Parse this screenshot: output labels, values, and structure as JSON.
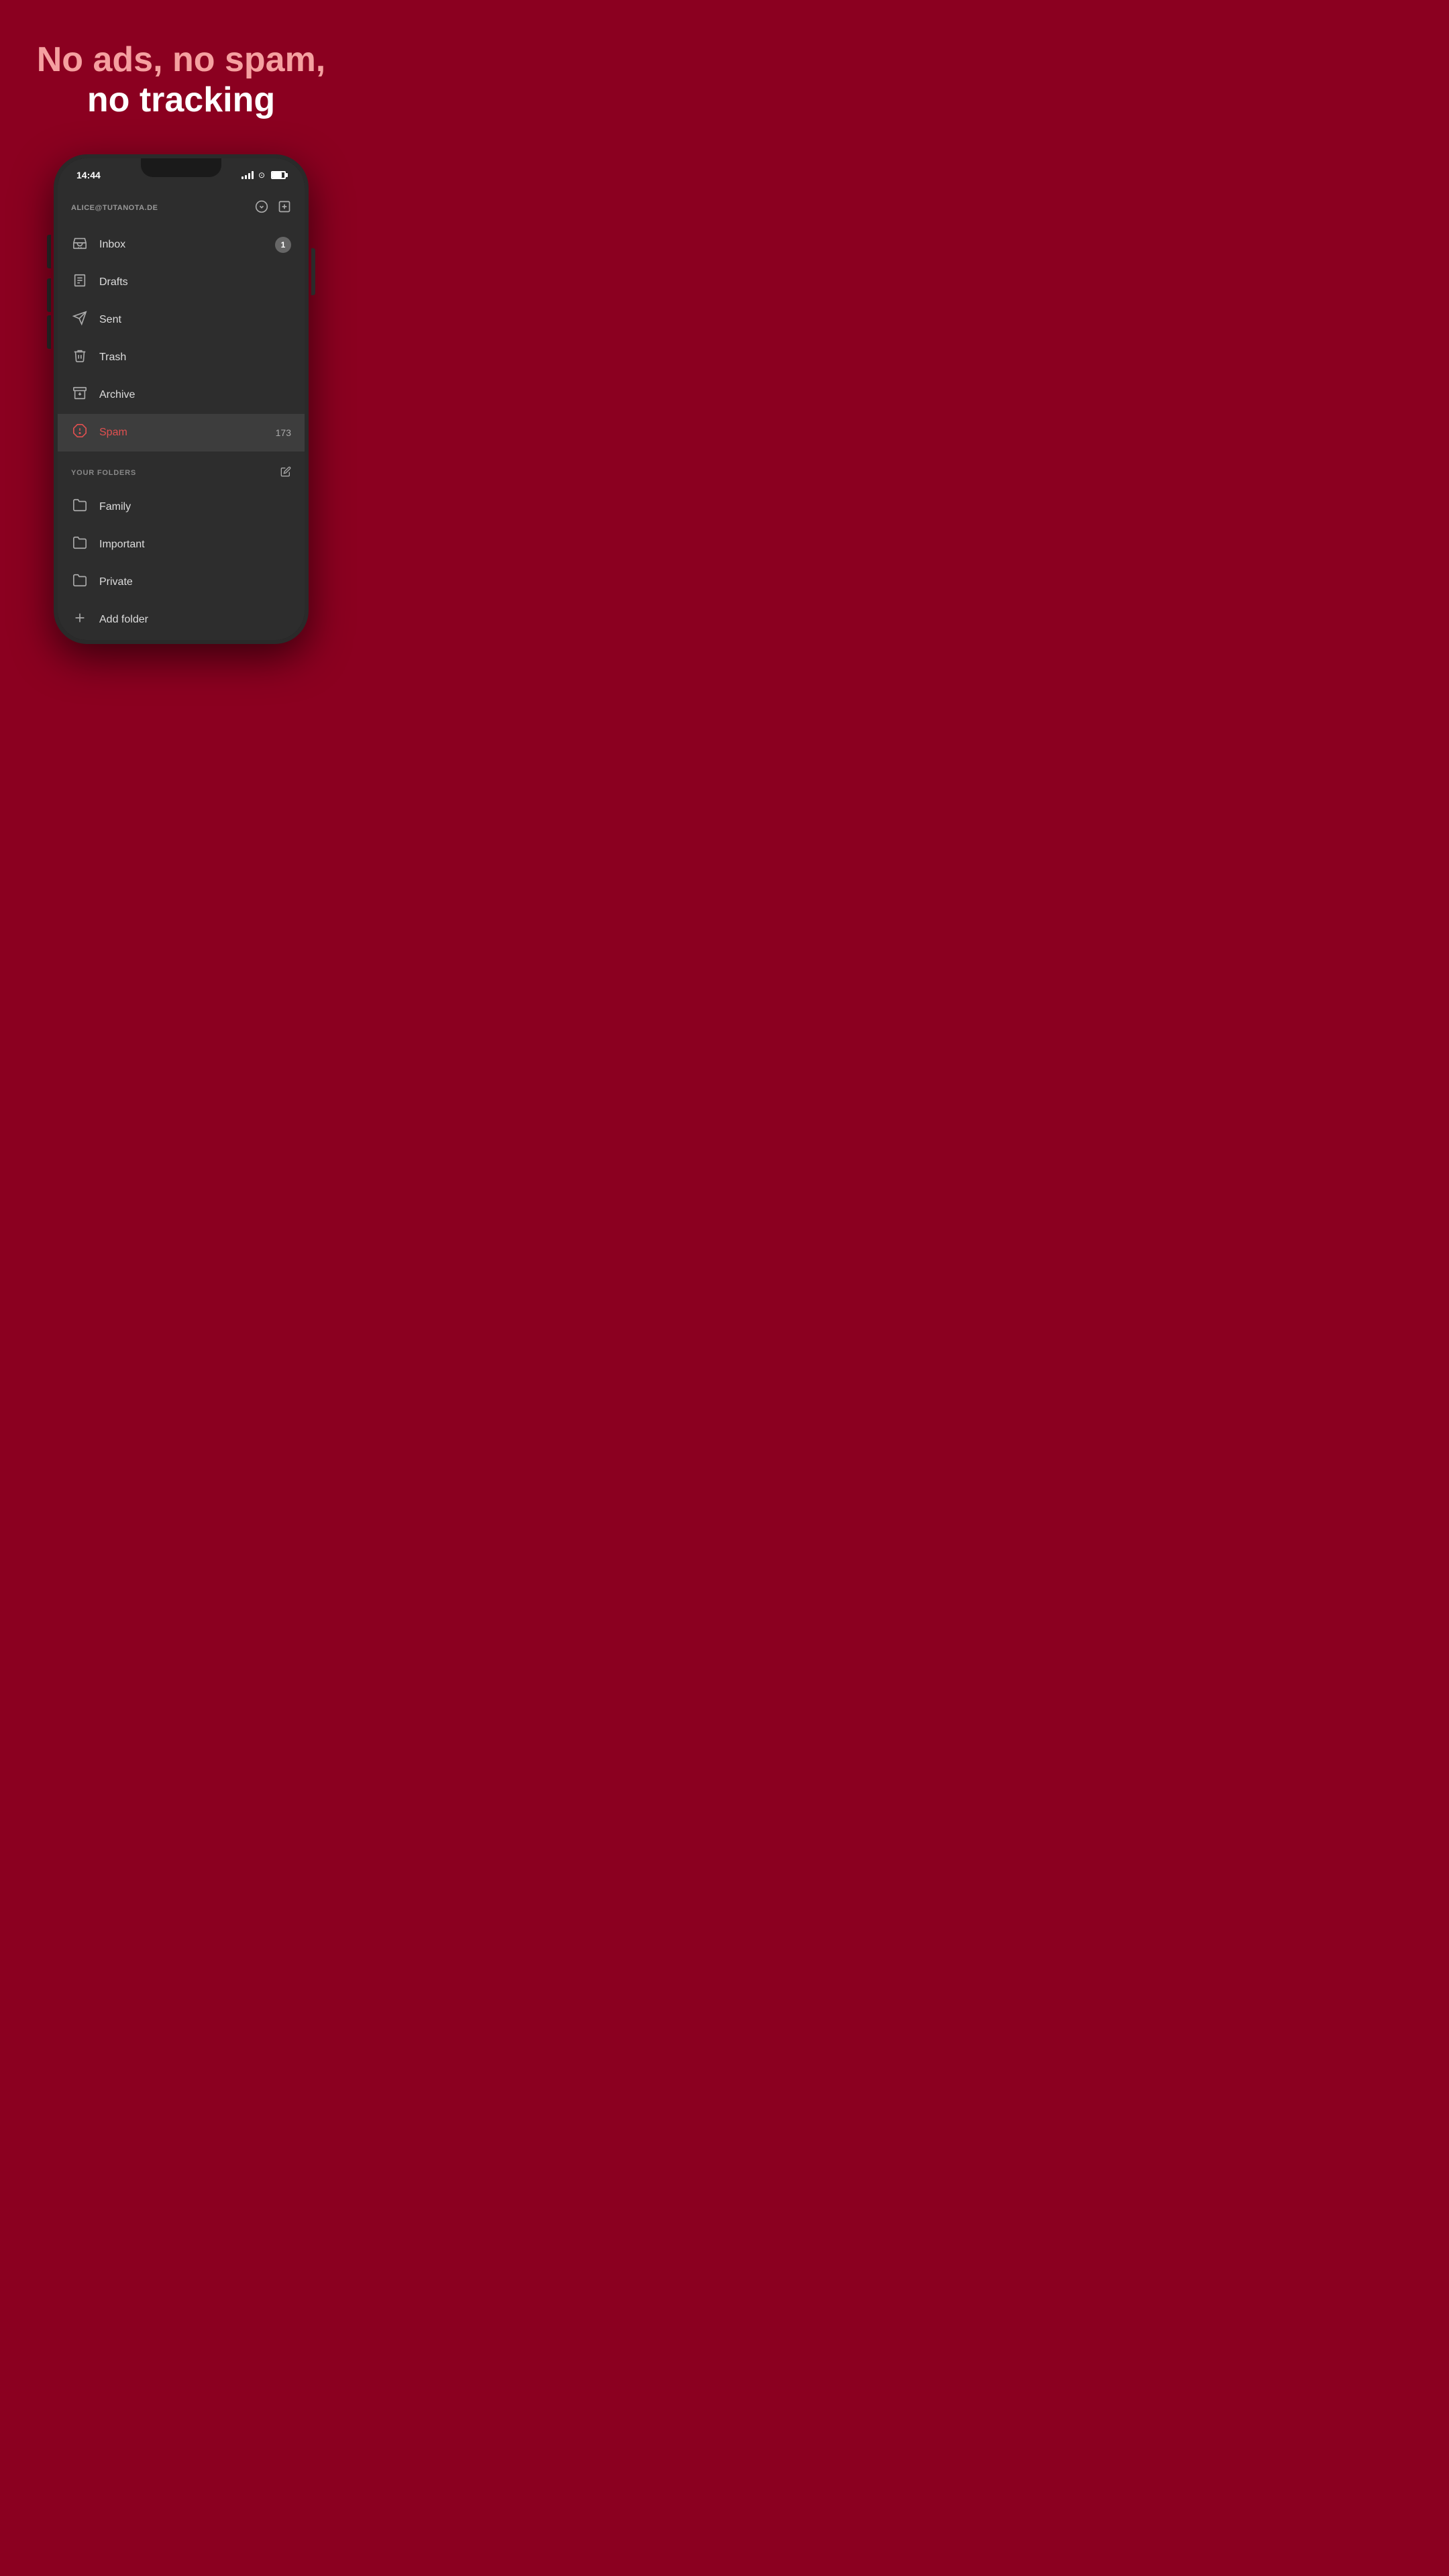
{
  "headline": {
    "line1": "No ads, no spam,",
    "line2": "no tracking"
  },
  "phone": {
    "status_bar": {
      "time": "14:44"
    },
    "account": {
      "email": "ALICE@TUTANOTA.DE"
    },
    "nav_items": [
      {
        "id": "inbox",
        "label": "Inbox",
        "badge": "1",
        "active": false
      },
      {
        "id": "drafts",
        "label": "Drafts",
        "badge": null,
        "active": false
      },
      {
        "id": "sent",
        "label": "Sent",
        "badge": null,
        "active": false
      },
      {
        "id": "trash",
        "label": "Trash",
        "badge": null,
        "active": false
      },
      {
        "id": "archive",
        "label": "Archive",
        "badge": null,
        "active": false
      },
      {
        "id": "spam",
        "label": "Spam",
        "badge": "173",
        "active": true
      }
    ],
    "folders_section": {
      "title": "YOUR FOLDERS",
      "items": [
        {
          "id": "family",
          "label": "Family"
        },
        {
          "id": "important",
          "label": "Important"
        },
        {
          "id": "private",
          "label": "Private"
        }
      ],
      "add_label": "Add folder"
    }
  },
  "colors": {
    "background": "#8B0020",
    "headline_pink": "#F5A0A0",
    "headline_white": "#ffffff",
    "sidebar_bg": "#2d2d2d",
    "active_item": "#3d3d3d",
    "spam_red": "#e05050",
    "text_primary": "#dddddd",
    "text_secondary": "#aaaaaa",
    "text_muted": "#888888"
  }
}
